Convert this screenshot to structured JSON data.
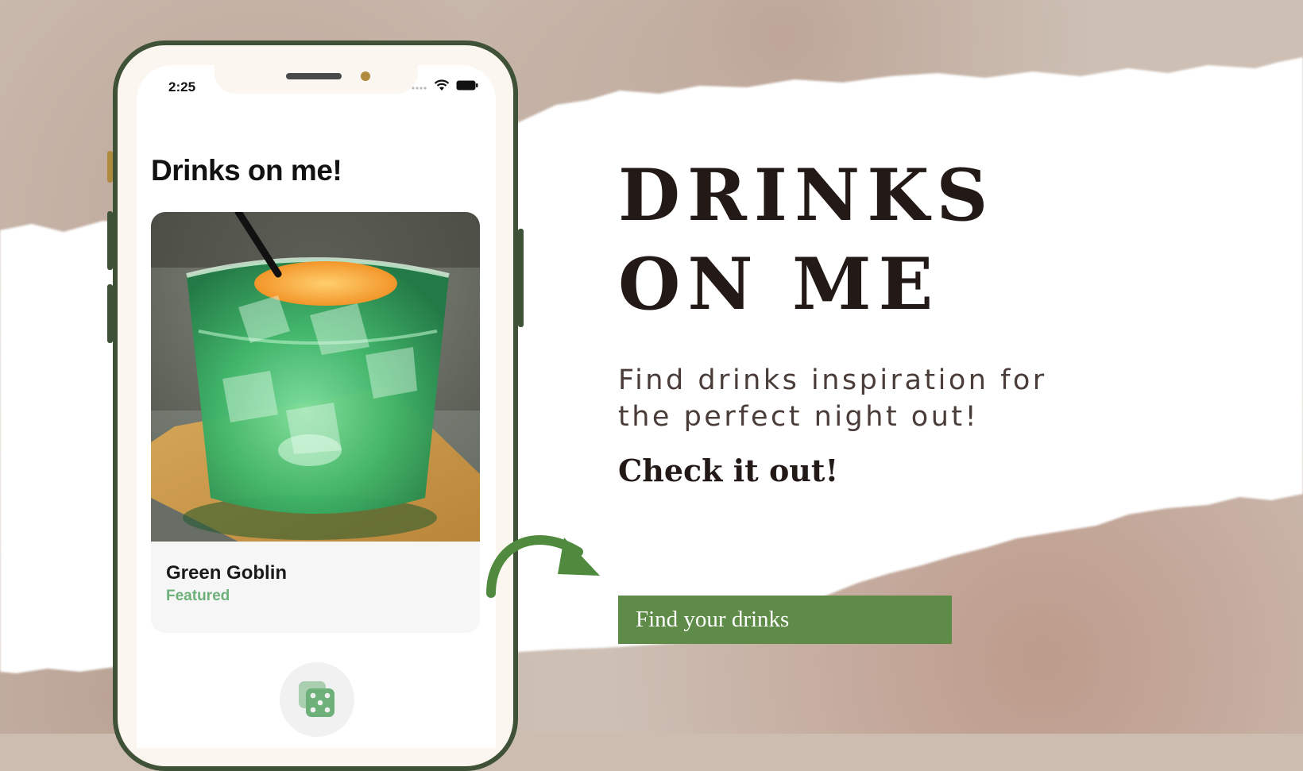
{
  "colors": {
    "accent_green": "#5e8b48",
    "phone_frame": "#3f5238",
    "featured_green": "#6db07a",
    "heading_dark": "#231a17"
  },
  "phone": {
    "status_time": "2:25",
    "app_title": "Drinks on me!",
    "card": {
      "name": "Green Goblin",
      "tag": "Featured",
      "image": "green-cocktail-photo"
    },
    "random_button_icon": "dice-icon"
  },
  "hero": {
    "title": "DRINKS\nON ME",
    "subtitle": "Find drinks inspiration for\nthe perfect night out!",
    "cta_text": "Check it out!",
    "button_label": "Find your drinks"
  }
}
